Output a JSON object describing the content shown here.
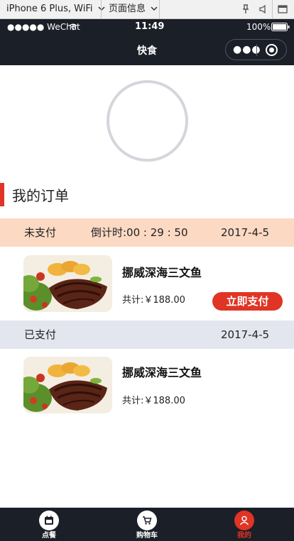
{
  "devtools": {
    "device": "iPhone 6 Plus, WiFi",
    "page_info": "页面信息",
    "pin_icon": "pin-icon",
    "volume_icon": "volume-icon",
    "window_icon": "window-icon"
  },
  "status_bar": {
    "carrier": "●●●●● WeChat",
    "time": "11:49",
    "battery": "100%"
  },
  "navbar": {
    "title": "快食"
  },
  "section": {
    "title": "我的订单"
  },
  "orders": [
    {
      "status": "未支付",
      "countdown": "倒计时:00 : 29 : 50",
      "date": "2017-4-5",
      "item_name": "挪威深海三文鱼",
      "total": "共计:￥188.00",
      "pay_button": "立即支付",
      "header_color": "#fcd9c3"
    },
    {
      "status": "已支付",
      "date": "2017-4-5",
      "item_name": "挪威深海三文鱼",
      "total": "共计:￥188.00",
      "header_color": "#e4e6ef"
    }
  ],
  "tabbar": {
    "items": [
      {
        "label": "点餐",
        "icon": "calendar-icon"
      },
      {
        "label": "购物车",
        "icon": "cart-icon"
      },
      {
        "label": "我的",
        "icon": "user-icon",
        "active": true
      }
    ],
    "accent": "#e03424"
  }
}
